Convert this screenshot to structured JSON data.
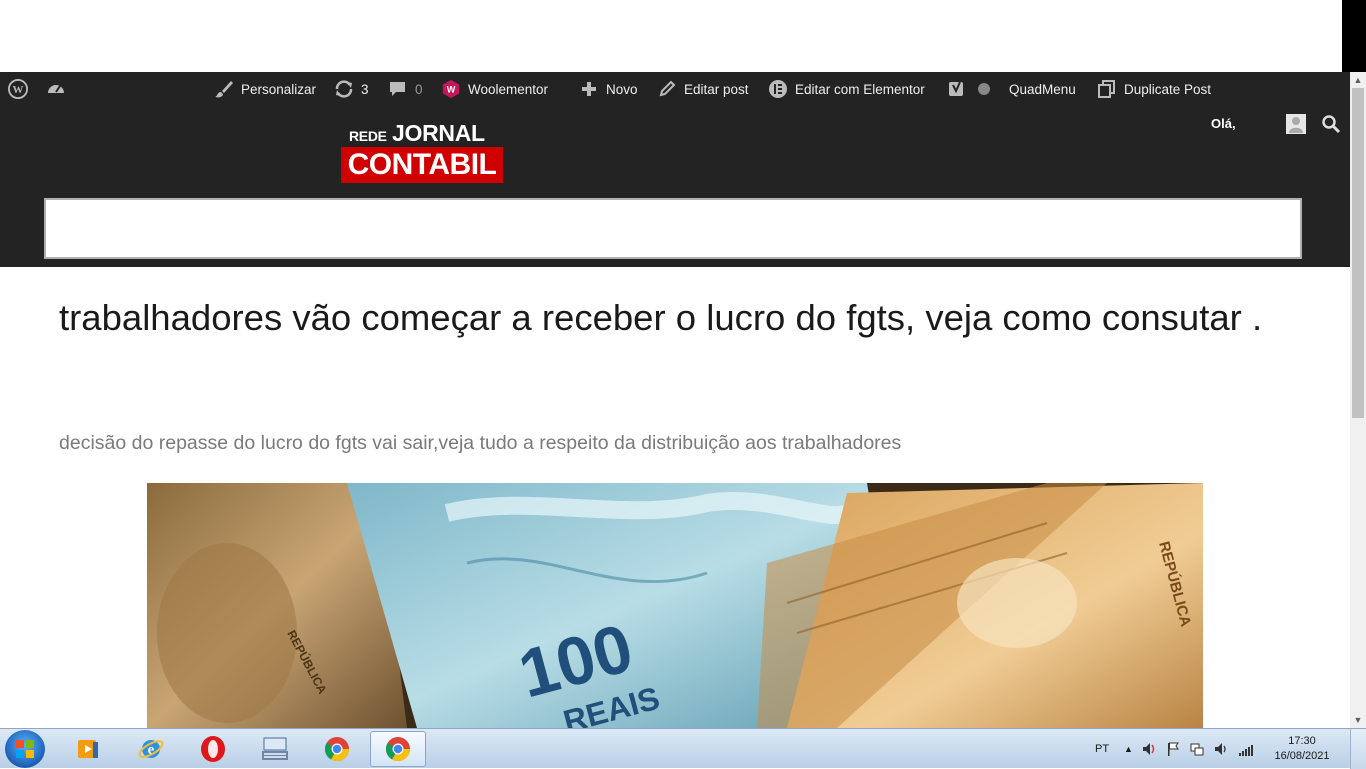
{
  "admin_bar": {
    "wp_logo_icon": "wordpress-icon",
    "dashboard_icon": "dashboard-icon",
    "customize_label": "Personalizar",
    "updates_count": "3",
    "comments_count": "0",
    "woolementor_label": "Woolementor",
    "new_label": "Novo",
    "edit_post_label": "Editar post",
    "edit_elementor_label": "Editar com Elementor",
    "quadmenu_label": "QuadMenu",
    "duplicate_label": "Duplicate Post"
  },
  "header": {
    "logo_rede": "REDE",
    "logo_jornal": "JORNAL",
    "logo_contabil": "CONTABIL",
    "greeting": "Olá,",
    "brand_red": "#d10000",
    "bg_color": "#232323"
  },
  "article": {
    "title": "trabalhadores vão  começar a receber o lucro do fgts, veja como consutar .",
    "subtitle": "decisão do repasse do lucro do fgts vai sair,veja tudo a respeito da distribuição aos trabalhadores",
    "image_note_text": "100",
    "image_currency_text": "REAIS",
    "image_republica_left": "REPÚBLICA",
    "image_republica_right": "REPÚBLICA"
  },
  "taskbar": {
    "language": "PT",
    "time": "17:30",
    "date": "16/08/2021",
    "apps": [
      "media-player-icon",
      "internet-explorer-icon",
      "opera-icon",
      "keyboard-app-icon",
      "chrome-icon",
      "chrome-active-icon"
    ]
  }
}
